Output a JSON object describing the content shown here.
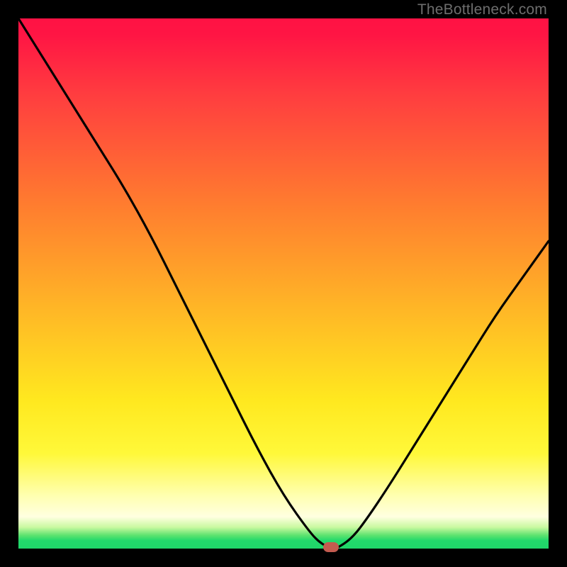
{
  "attribution": "TheBottleneck.com",
  "colors": {
    "frame": "#000000",
    "gradient_top": "#ff1244",
    "gradient_mid1": "#ff7c2f",
    "gradient_mid2": "#ffe81f",
    "gradient_bottom_band": "#1fd66a",
    "curve": "#000000",
    "marker": "#c35b4f"
  },
  "chart_data": {
    "type": "line",
    "title": "",
    "xlabel": "",
    "ylabel": "",
    "xlim": [
      0,
      100
    ],
    "ylim": [
      0,
      100
    ],
    "x": [
      0,
      5,
      10,
      15,
      20,
      25,
      30,
      35,
      40,
      45,
      50,
      55,
      57,
      59,
      60,
      63,
      66,
      70,
      75,
      80,
      85,
      90,
      95,
      100
    ],
    "y": [
      100,
      92,
      84,
      76,
      68,
      59,
      49,
      39,
      29,
      19,
      10,
      3,
      1,
      0,
      0,
      2,
      6,
      12,
      20,
      28,
      36,
      44,
      51,
      58
    ],
    "marker": {
      "x": 59,
      "y": 0
    },
    "notes": "V-shaped bottleneck curve; gradient background encodes severity (red=high, green=optimal). No axis ticks or labels visible."
  }
}
